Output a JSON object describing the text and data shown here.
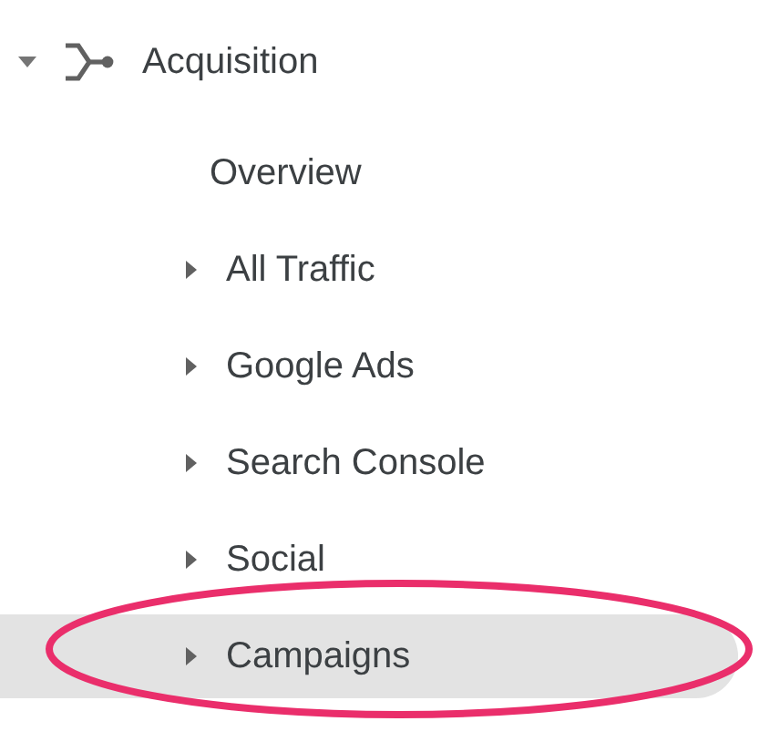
{
  "section": {
    "label": "Acquisition",
    "expanded": true
  },
  "items": [
    {
      "label": "Overview",
      "kind": "leaf",
      "selected": false,
      "annotated": false
    },
    {
      "label": "All Traffic",
      "kind": "group",
      "selected": false,
      "annotated": false
    },
    {
      "label": "Google Ads",
      "kind": "group",
      "selected": false,
      "annotated": false
    },
    {
      "label": "Search Console",
      "kind": "group",
      "selected": false,
      "annotated": false
    },
    {
      "label": "Social",
      "kind": "group",
      "selected": false,
      "annotated": false
    },
    {
      "label": "Campaigns",
      "kind": "group",
      "selected": true,
      "annotated": true
    }
  ]
}
